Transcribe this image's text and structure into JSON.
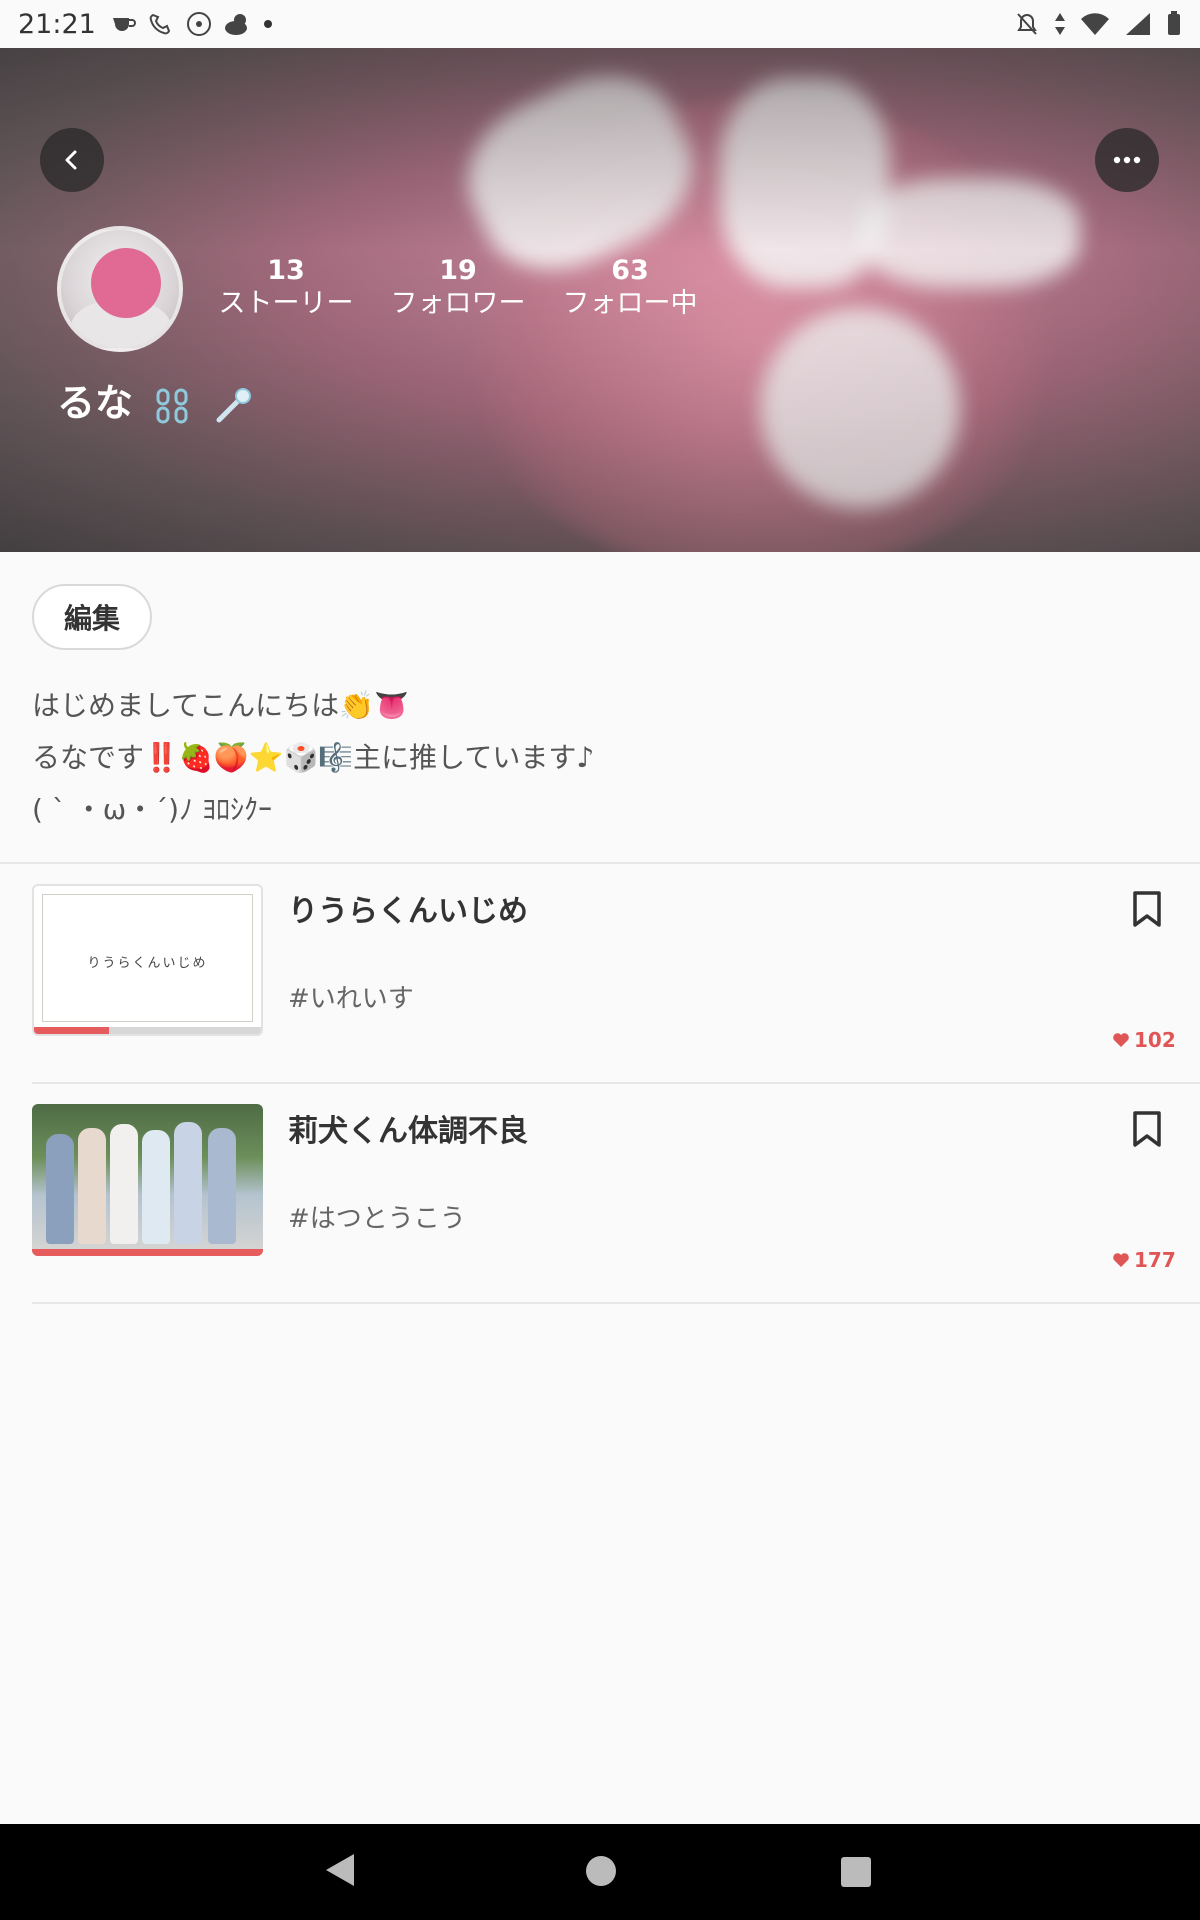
{
  "status_bar": {
    "time": "21:21"
  },
  "profile": {
    "stats": [
      {
        "value": "13",
        "label": "ストーリー"
      },
      {
        "value": "19",
        "label": "フォロワー"
      },
      {
        "value": "63",
        "label": "フォロー中"
      }
    ],
    "username": "るな",
    "edit_label": "編集",
    "bio": [
      "はじめましてこんにちは👏👅",
      "るなです‼️🍓🍑⭐🎲🎼主に推しています♪",
      "( ˋ ・ω・´)ﾉ ﾖﾛｼｸｰ"
    ]
  },
  "stories": [
    {
      "title": "りうらくんいじめ",
      "thumb_text": "りうらくんいじめ",
      "tag": "#いれいす",
      "likes": "102",
      "progress": 0.33
    },
    {
      "title": "莉犬くん体調不良",
      "tag": "#はつとうこう",
      "likes": "177",
      "progress": 1.0
    }
  ],
  "colors": {
    "accent": "#e65b5b",
    "like": "#e05555"
  },
  "icons": {
    "back": "chevron-left-icon",
    "more": "more-horizontal-icon",
    "bookmark": "bookmark-icon",
    "heart": "heart-icon"
  }
}
